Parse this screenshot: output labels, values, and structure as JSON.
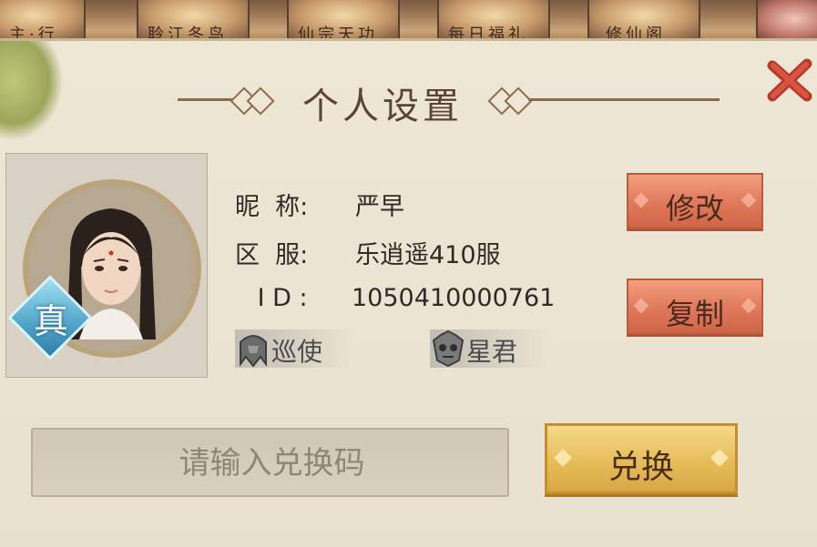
{
  "top_strip": {
    "texts": [
      "主·行",
      "聆江冬鸟",
      "仙宗天功",
      "每日福礼",
      "修仙阁"
    ]
  },
  "panel": {
    "title": "个人设置"
  },
  "profile": {
    "badge_char": "真",
    "nickname_label": "昵  称:",
    "nickname": "严早",
    "server_label": "区  服:",
    "server": "乐逍遥410服",
    "id_label": " I D :",
    "id": "1050410000761"
  },
  "titles": [
    {
      "name": "巡使",
      "icon": "helmet-emblem-icon"
    },
    {
      "name": "星君",
      "icon": "skull-emblem-icon"
    }
  ],
  "buttons": {
    "modify": "修改",
    "copy": "复制",
    "redeem": "兑换"
  },
  "redeem": {
    "placeholder": "请输入兑换码"
  },
  "colors": {
    "red_button": "#e07b5c",
    "gold_button": "#e8bf5e",
    "close_x": "#d24a3a",
    "badge_blue": "#4ea3c8"
  }
}
